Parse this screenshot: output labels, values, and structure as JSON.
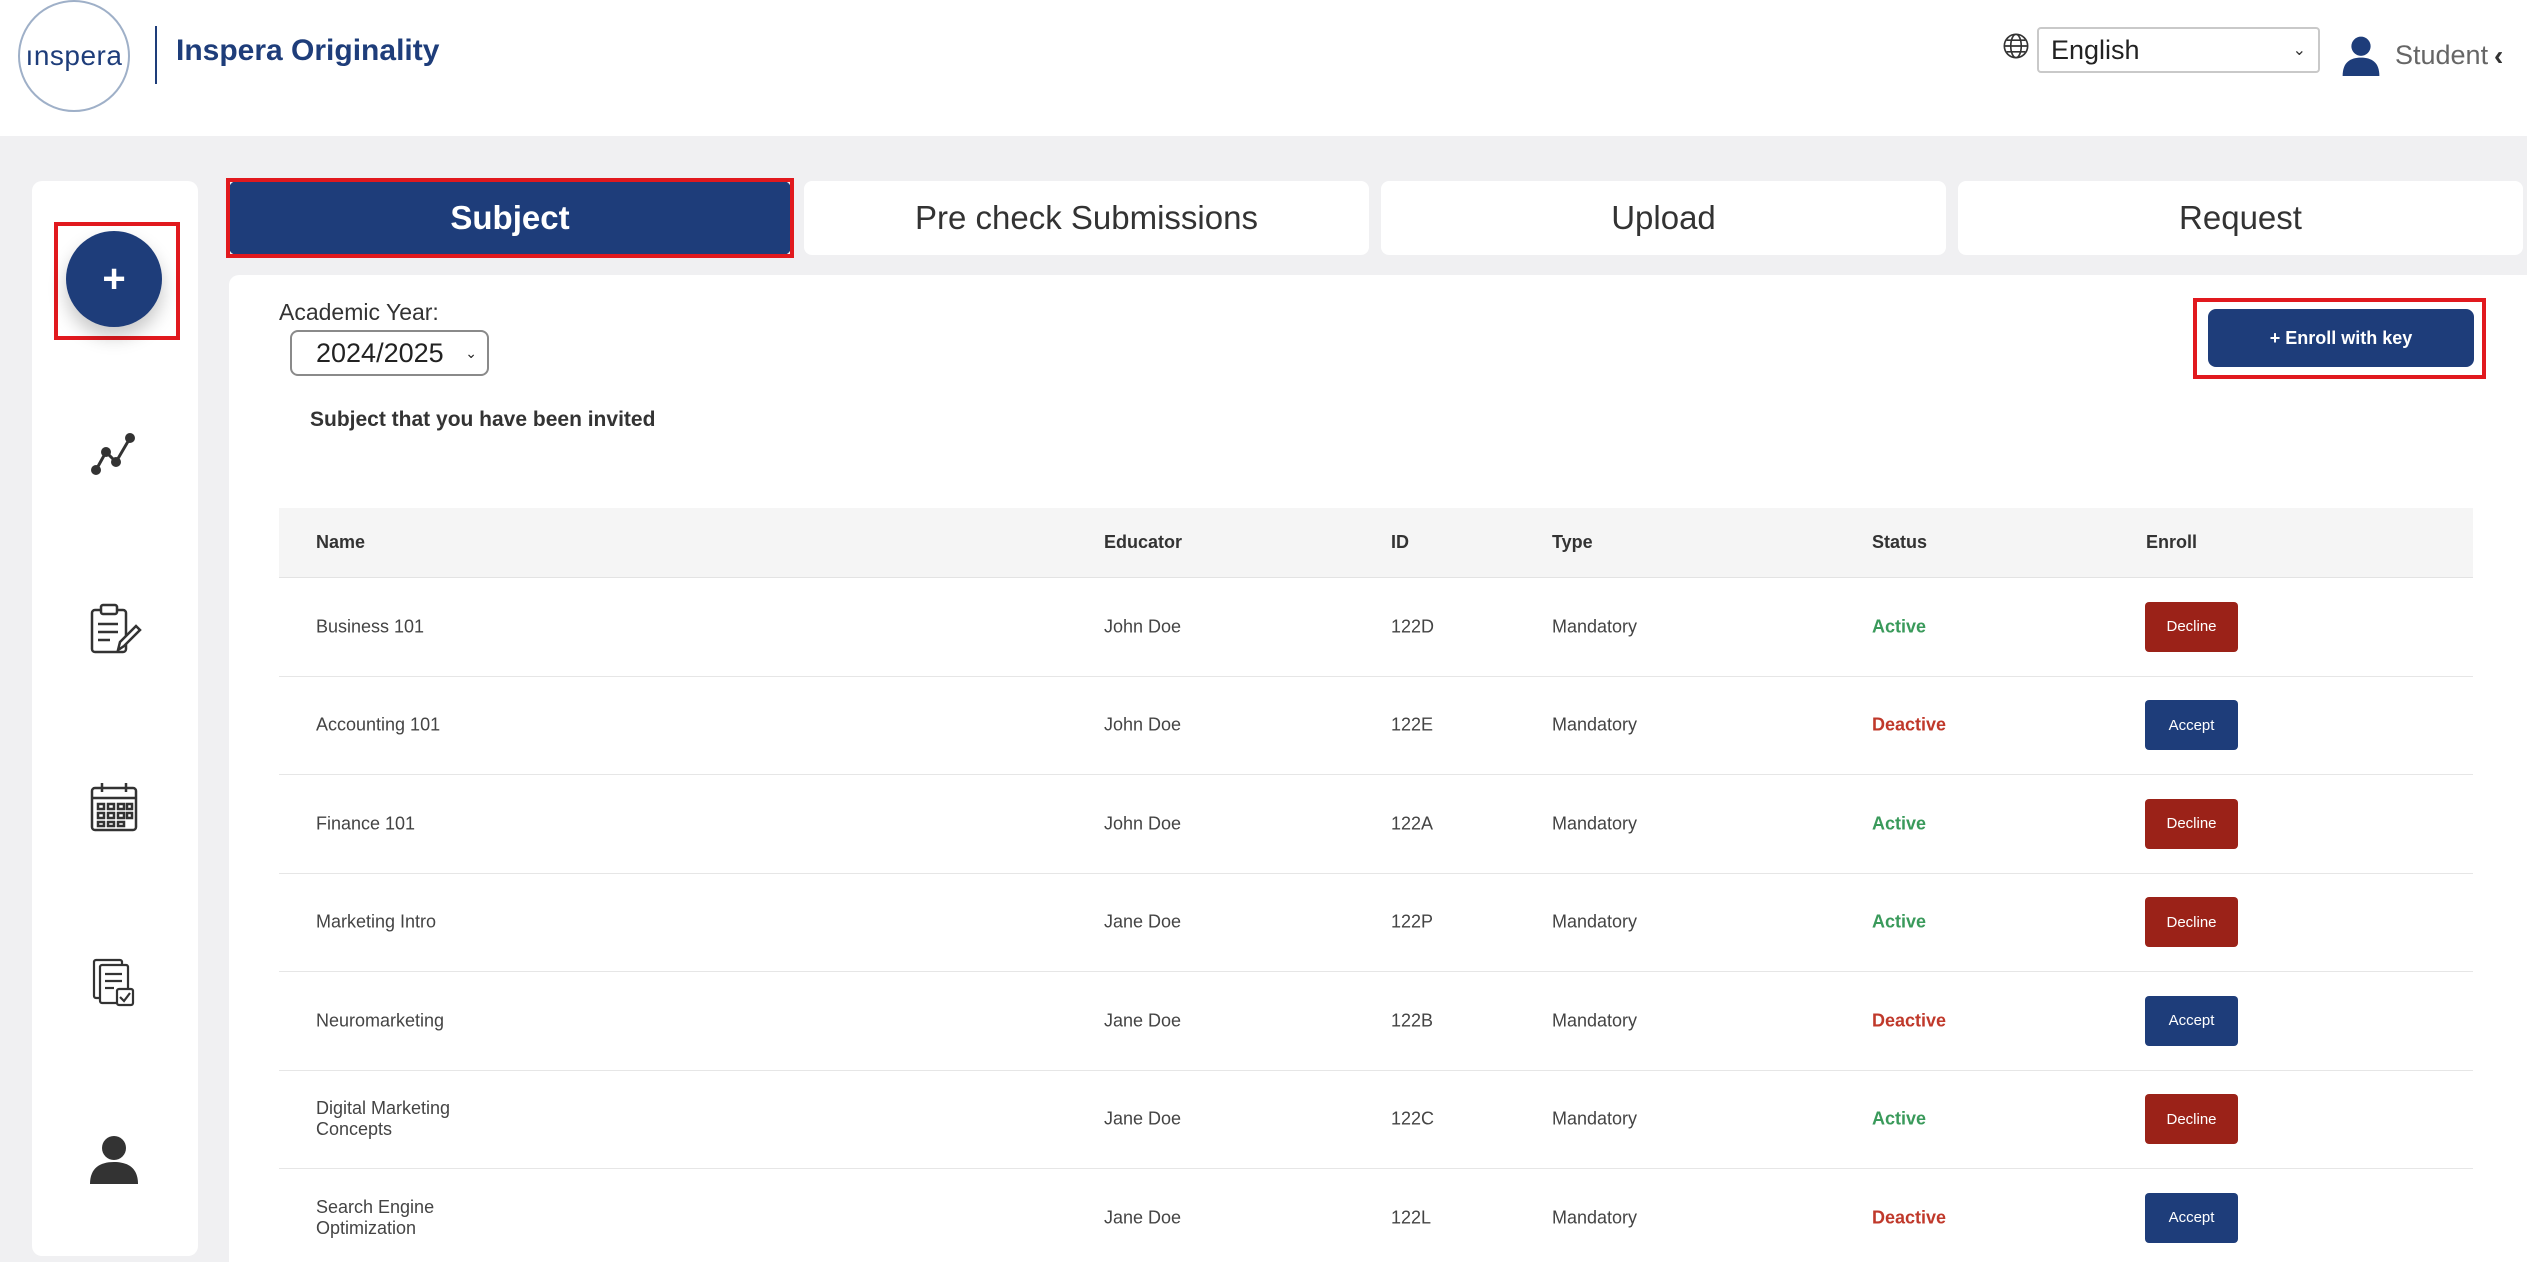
{
  "header": {
    "logo_text": "ınspera",
    "app_title": "Inspera Originality",
    "language": "English",
    "user_label": "Student"
  },
  "sidebar": {
    "items": [
      {
        "icon": "plus-icon",
        "label": "+"
      },
      {
        "icon": "analytics-icon"
      },
      {
        "icon": "assignment-edit-icon"
      },
      {
        "icon": "calendar-icon"
      },
      {
        "icon": "document-check-icon"
      },
      {
        "icon": "profile-icon"
      }
    ]
  },
  "tabs": [
    {
      "label": "Subject",
      "active": true
    },
    {
      "label": "Pre check Submissions",
      "active": false
    },
    {
      "label": "Upload",
      "active": false
    },
    {
      "label": "Request",
      "active": false
    }
  ],
  "filters": {
    "academic_year_label": "Academic Year:",
    "academic_year_value": "2024/2025"
  },
  "section_title": "Subject that you have been invited",
  "enroll_button_label": "+ Enroll with key",
  "table": {
    "headers": [
      "Name",
      "Educator",
      "ID",
      "Type",
      "Status",
      "Enroll"
    ],
    "rows": [
      {
        "name": "Business 101",
        "educator": "John Doe",
        "id": "122D",
        "type": "Mandatory",
        "status": "Active",
        "action": "Decline"
      },
      {
        "name": "Accounting 101",
        "educator": "John Doe",
        "id": "122E",
        "type": "Mandatory",
        "status": "Deactive",
        "action": "Accept"
      },
      {
        "name": "Finance 101",
        "educator": "John Doe",
        "id": "122A",
        "type": "Mandatory",
        "status": "Active",
        "action": "Decline"
      },
      {
        "name": "Marketing Intro",
        "educator": "Jane Doe",
        "id": "122P",
        "type": "Mandatory",
        "status": "Active",
        "action": "Decline"
      },
      {
        "name": "Neuromarketing",
        "educator": "Jane Doe",
        "id": "122B",
        "type": "Mandatory",
        "status": "Deactive",
        "action": "Accept"
      },
      {
        "name": "Digital Marketing Concepts",
        "educator": "Jane Doe",
        "id": "122C",
        "type": "Mandatory",
        "status": "Active",
        "action": "Decline"
      },
      {
        "name": "Search Engine Optimization",
        "educator": "Jane Doe",
        "id": "122L",
        "type": "Mandatory",
        "status": "Deactive",
        "action": "Accept"
      }
    ]
  },
  "colors": {
    "primary": "#1e3d7a",
    "highlight": "#e1191e",
    "active": "#3a9a5b",
    "deactive": "#c0392b",
    "decline": "#9b2218"
  }
}
